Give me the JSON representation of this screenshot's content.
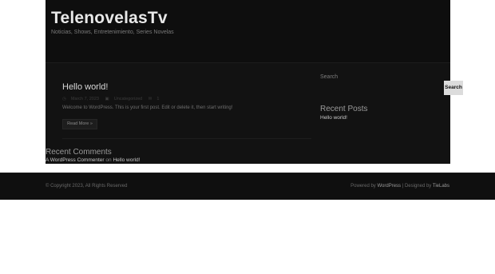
{
  "site": {
    "title": "TelenovelasTv",
    "tagline": "Noticias, Shows, Entretenimiento, Series Novelas"
  },
  "post": {
    "title": "Hello world!",
    "date": "March 7, 2023",
    "category": "Uncategorized",
    "comments_count": "1",
    "excerpt": "Welcome to WordPress. This is your first post. Edit or delete it, then start writing!",
    "read_more": "Read More »"
  },
  "sidebar": {
    "search_label": "Search",
    "search_button": "Search",
    "recent_posts_title": "Recent Posts",
    "recent_posts": [
      "Hello world!"
    ]
  },
  "recent_comments": {
    "title": "Recent Comments",
    "author": "A WordPress Commenter",
    "on_text": "on",
    "post": "Hello world!"
  },
  "footer": {
    "copyright": "© Copyright 2023, All Rights Reserved",
    "powered_by_text": "Powered by",
    "wordpress_link": "WordPress",
    "designed_by_text": "| Designed by",
    "designer_link": "TieLabs"
  },
  "colors": {
    "background": "#121212",
    "header": "#0e0e0e",
    "button": "#dcdcdc"
  }
}
